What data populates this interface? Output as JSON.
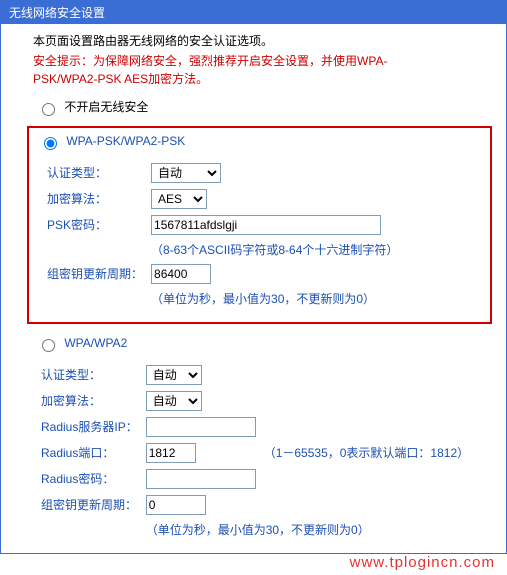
{
  "titlebar": "无线网络安全设置",
  "intro": "本页面设置路由器无线网络的安全认证选项。",
  "warn_line1": "安全提示：为保障网络安全，强烈推荐开启安全设置，并使用WPA-",
  "warn_line2": "PSK/WPA2-PSK AES加密方法。",
  "radios": {
    "none": "不开启无线安全",
    "wpapsk": "WPA-PSK/WPA2-PSK",
    "wpa": "WPA/WPA2"
  },
  "labels": {
    "auth": "认证类型：",
    "enc": "加密算法：",
    "psk": "PSK密码：",
    "gkey": "组密钥更新周期：",
    "radius_ip": "Radius服务器IP：",
    "radius_port": "Radius端口：",
    "radius_pw": "Radius密码："
  },
  "wpapsk": {
    "auth": "自动",
    "enc": "AES",
    "psk": "1567811afdslgji",
    "psk_hint": "（8-63个ASCII码字符或8-64个十六进制字符）",
    "gkey": "86400",
    "gkey_hint": "（单位为秒，最小值为30，不更新则为0）"
  },
  "wpa": {
    "auth": "自动",
    "enc": "自动",
    "radius_ip": "",
    "radius_port": "1812",
    "radius_port_hint": "（1－65535，0表示默认端口：1812）",
    "radius_pw": "",
    "gkey": "0",
    "gkey_hint": "（单位为秒，最小值为30，不更新则为0）"
  },
  "watermark": "www.tplogincn.com"
}
